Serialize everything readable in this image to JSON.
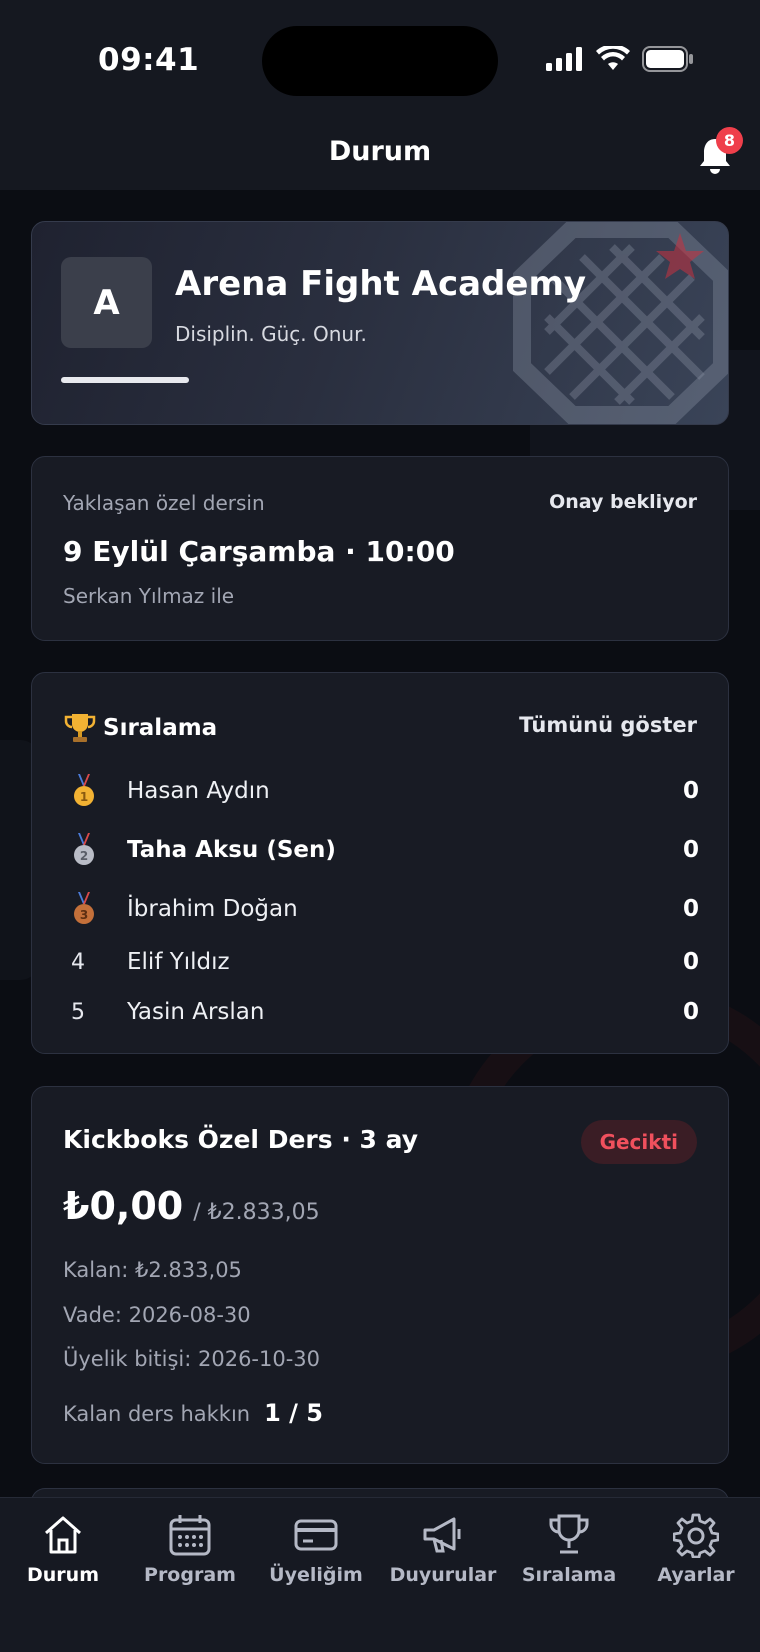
{
  "status_bar": {
    "time": "09:41"
  },
  "header": {
    "title": "Durum",
    "notifications_count": "8"
  },
  "club": {
    "initial": "A",
    "name": "Arena Fight Academy",
    "tagline": "Disiplin. Güç. Onur."
  },
  "upcoming": {
    "label": "Yaklaşan özel dersin",
    "status": "Onay bekliyor",
    "datetime": "9 Eylül Çarşamba · 10:00",
    "trainer": "Serkan Yılmaz ile"
  },
  "ranking": {
    "title": "Sıralama",
    "show_all": "Tümünü göster",
    "rows": [
      {
        "pos": "1",
        "name": "Hasan Aydın",
        "score": "0",
        "medal": "gold-medal-icon"
      },
      {
        "pos": "2",
        "name": "Taha Aksu (Sen)",
        "score": "0",
        "medal": "silver-medal-icon"
      },
      {
        "pos": "3",
        "name": "İbrahim Doğan",
        "score": "0",
        "medal": "bronze-medal-icon"
      },
      {
        "pos": "4",
        "name": "Elif Yıldız",
        "score": "0"
      },
      {
        "pos": "5",
        "name": "Yasin Arslan",
        "score": "0"
      }
    ]
  },
  "membership": {
    "title": "Kickboks Özel Ders · 3 ay",
    "status": "Gecikti",
    "paid": "₺0,00",
    "total": "/ ₺2.833,05",
    "remaining": "Kalan: ₺2.833,05",
    "due": "Vade: 2026-08-30",
    "end": "Üyelik bitişi: 2026-10-30",
    "lessons_label": "Kalan ders hakkın",
    "lessons_value": "1 / 5"
  },
  "tabs": [
    {
      "label": "Durum",
      "icon": "home-icon",
      "active": true
    },
    {
      "label": "Program",
      "icon": "calendar-icon"
    },
    {
      "label": "Üyeliğim",
      "icon": "card-icon"
    },
    {
      "label": "Duyurular",
      "icon": "megaphone-icon"
    },
    {
      "label": "Sıralama",
      "icon": "trophy-icon"
    },
    {
      "label": "Ayarlar",
      "icon": "gear-icon"
    }
  ],
  "colors": {
    "background": "#0b0d13",
    "card": "#181b24",
    "accent_red": "#ef3f4b",
    "gold": "#f2b233",
    "silver": "#b9bcc6",
    "bronze": "#c4703a"
  }
}
